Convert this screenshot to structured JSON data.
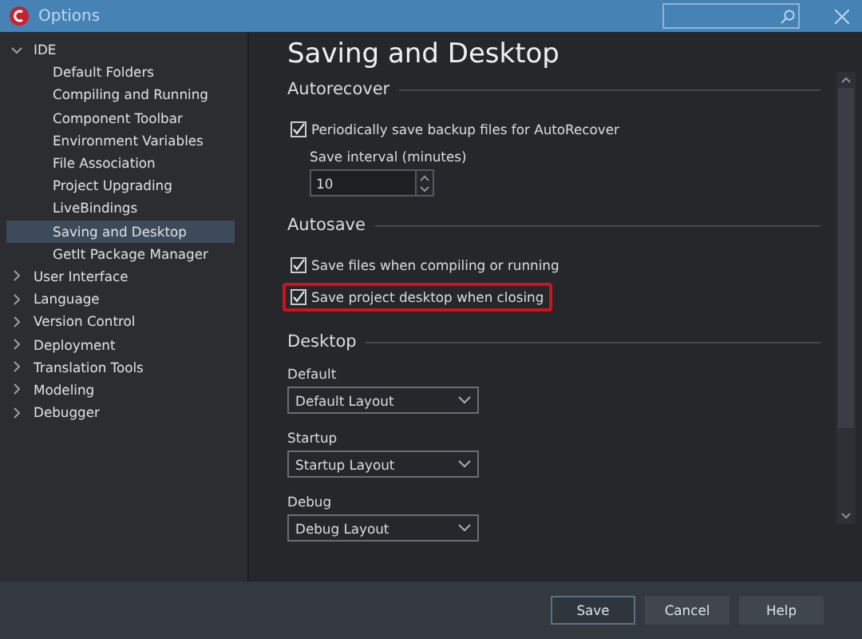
{
  "window": {
    "title": "Options"
  },
  "sidebar": {
    "items": [
      {
        "label": "IDE",
        "expanded": true,
        "selected": false,
        "children": [
          {
            "label": "Default Folders",
            "selected": false
          },
          {
            "label": "Compiling and Running",
            "selected": false
          },
          {
            "label": "Component Toolbar",
            "selected": false
          },
          {
            "label": "Environment Variables",
            "selected": false
          },
          {
            "label": "File Association",
            "selected": false
          },
          {
            "label": "Project Upgrading",
            "selected": false
          },
          {
            "label": "LiveBindings",
            "selected": false
          },
          {
            "label": "Saving and Desktop",
            "selected": true
          },
          {
            "label": "GetIt Package Manager",
            "selected": false
          }
        ]
      },
      {
        "label": "User Interface",
        "expanded": false,
        "selected": false
      },
      {
        "label": "Language",
        "expanded": false,
        "selected": false
      },
      {
        "label": "Version Control",
        "expanded": false,
        "selected": false
      },
      {
        "label": "Deployment",
        "expanded": false,
        "selected": false
      },
      {
        "label": "Translation Tools",
        "expanded": false,
        "selected": false
      },
      {
        "label": "Modeling",
        "expanded": false,
        "selected": false
      },
      {
        "label": "Debugger",
        "expanded": false,
        "selected": false
      }
    ]
  },
  "page": {
    "title": "Saving and Desktop",
    "sections": [
      {
        "heading": "Autorecover",
        "controls": [
          {
            "kind": "checkbox",
            "label": "Periodically save backup files for AutoRecover",
            "checked": true,
            "highlighted": false
          },
          {
            "kind": "spinner",
            "label": "Save interval (minutes)",
            "value": "10"
          }
        ]
      },
      {
        "heading": "Autosave",
        "controls": [
          {
            "kind": "checkbox",
            "label": "Save files when compiling or running",
            "checked": true,
            "highlighted": false
          },
          {
            "kind": "checkbox",
            "label": "Save project desktop when closing",
            "checked": true,
            "highlighted": true
          }
        ]
      },
      {
        "heading": "Desktop",
        "controls": [
          {
            "kind": "combo",
            "label": "Default",
            "value": "Default Layout"
          },
          {
            "kind": "combo",
            "label": "Startup",
            "value": "Startup Layout"
          },
          {
            "kind": "combo",
            "label": "Debug",
            "value": "Debug Layout"
          }
        ]
      }
    ]
  },
  "buttons": [
    {
      "label": "Save",
      "default": true
    },
    {
      "label": "Cancel",
      "default": false
    },
    {
      "label": "Help",
      "default": false
    }
  ]
}
